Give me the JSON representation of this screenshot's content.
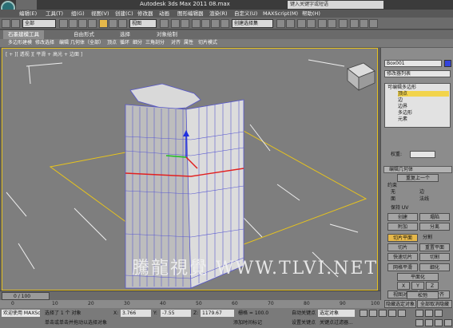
{
  "app": {
    "title": "Autodesk 3ds Max  2011     08.max",
    "search_placeholder": "键入关键字或短语"
  },
  "menu": [
    "编辑(E)",
    "工具(T)",
    "组(G)",
    "视图(V)",
    "创建(C)",
    "修改器",
    "动画",
    "图形编辑器",
    "渲染(R)",
    "自定义(U)",
    "MAXScript(M)",
    "帮助(H)"
  ],
  "toolbar": {
    "filter": "全部",
    "view": "视图",
    "selection_set": "创建选择集"
  },
  "ribbon": {
    "tabs": [
      "石墨建模工具",
      "自由形式",
      "选择",
      "对象绘制"
    ],
    "row": [
      "多边形建模",
      "修改选择",
      "编辑",
      "几何体（全部）",
      "顶点",
      "循环",
      "细分",
      "三角剖分",
      "对齐",
      "属性",
      "切片模式"
    ]
  },
  "viewport": {
    "label": "[ + ][ 透视 ][ 平滑 + 高光 + 边面 ]",
    "watermark": "騰龍視覺 WWW.TLVI.NET"
  },
  "panel": {
    "object_name": "Box001",
    "modifier_list": "修改器列表",
    "stack": [
      {
        "label": "可编辑多边形",
        "selected": false
      },
      {
        "label": "顶点",
        "selected": true
      },
      {
        "label": "边",
        "selected": false
      },
      {
        "label": "边界",
        "selected": false
      },
      {
        "label": "多边形",
        "selected": false
      },
      {
        "label": "元素",
        "selected": false
      }
    ],
    "weight_label": "权重:",
    "rollout_title": "编辑几何体",
    "repeat_last": "重复上一个",
    "constraints_label": "约束",
    "constraint_none": "无",
    "constraint_edge": "边",
    "constraint_face": "面",
    "constraint_normal": "法线",
    "preserve_uv": "保持 UV",
    "create": "创建",
    "collapse": "塌陷",
    "attach": "附加",
    "detach": "分离",
    "slice_plane": "切片平面",
    "split": "分割",
    "slice": "切片",
    "reset_plane": "重置平面",
    "quickslice": "快速切片",
    "cut": "切割",
    "meshsmooth": "网格平滑",
    "tessellate": "细化",
    "planarize": "平面化",
    "x": "X",
    "y": "Y",
    "z": "Z",
    "view_align": "视图对齐",
    "grid_align": "栅格对齐",
    "relax": "松弛",
    "hide_selected": "隐藏选定对象",
    "unhide_all": "全部取消隐藏"
  },
  "timeline": {
    "frame": "0 / 100",
    "ticks": [
      "0",
      "10",
      "20",
      "30",
      "40",
      "50",
      "60",
      "70",
      "80",
      "90",
      "100"
    ]
  },
  "status": {
    "welcome": "欢迎使用 MAXSc",
    "selected": "选择了 1 个 对象",
    "prompt": "单击或单击并拖动以选择对象",
    "x_label": "X:",
    "x_value": "3.766",
    "y_label": "Y:",
    "y_value": "-7.55",
    "z_label": "Z:",
    "z_value": "1179.67",
    "grid_label": "栅格 = 100.0",
    "add_time_tag": "添加时间标记",
    "auto_key": "自动关键点",
    "selected_obj": "选定对象",
    "set_key": "设置关键点",
    "key_filters": "关键点过滤器..."
  }
}
